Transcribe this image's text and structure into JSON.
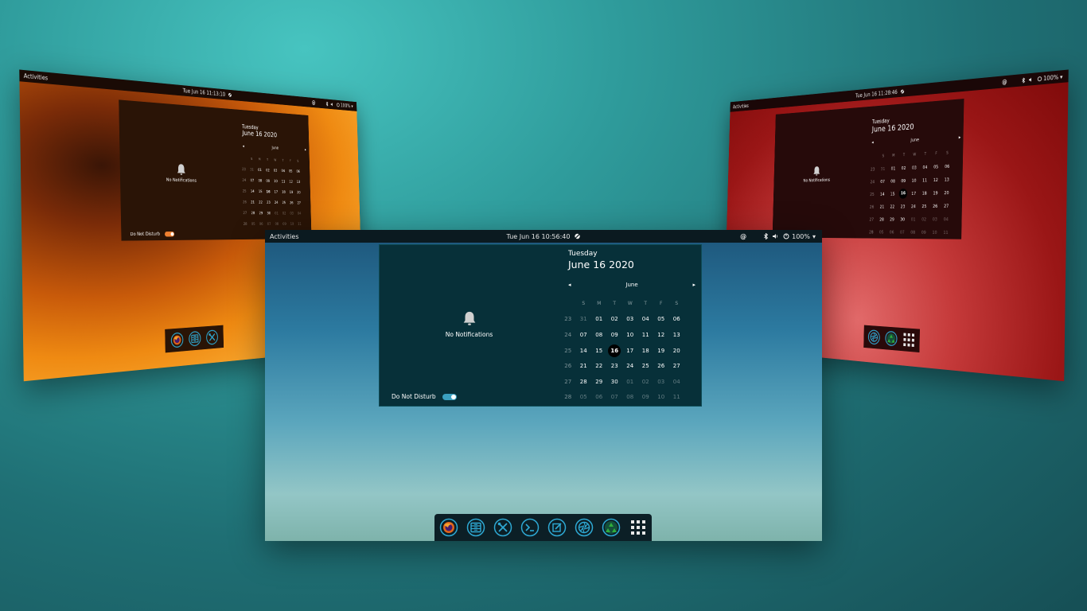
{
  "screens": {
    "orange": {
      "activities": "Activities",
      "clock": "Tue Jun 16  11:13:10",
      "tray_at": "@",
      "battery": "100%",
      "popup": {
        "weekday": "Tuesday",
        "date": "June 16 2020",
        "month": "June",
        "no_notifications": "No Notifications",
        "dnd_label": "Do Not Disturb"
      },
      "accent": "#f08030"
    },
    "red": {
      "activities": "Activities",
      "clock": "Tue Jun 16  11:28:46",
      "tray_at": "@",
      "battery": "100%",
      "popup": {
        "weekday": "Tuesday",
        "date": "June 16 2020",
        "month": "June",
        "no_notifications": "No Notifications"
      },
      "accent": "#b81f1f"
    },
    "main": {
      "activities": "Activities",
      "clock": "Tue Jun 16  10:56:40",
      "tray_at": "@",
      "battery": "100%",
      "popup": {
        "weekday": "Tuesday",
        "date": "June 16 2020",
        "month": "June",
        "no_notifications": "No Notifications",
        "dnd_label": "Do Not Disturb"
      },
      "accent": "#3aa0c0"
    }
  },
  "calendar": {
    "day_headers": [
      "S",
      "M",
      "T",
      "W",
      "T",
      "F",
      "S"
    ],
    "weeks": [
      {
        "wk": "23",
        "days": [
          "31",
          "01",
          "02",
          "03",
          "04",
          "05",
          "06"
        ],
        "dim": [
          true,
          false,
          false,
          false,
          false,
          false,
          false
        ]
      },
      {
        "wk": "24",
        "days": [
          "07",
          "08",
          "09",
          "10",
          "11",
          "12",
          "13"
        ],
        "dim": [
          false,
          false,
          false,
          false,
          false,
          false,
          false
        ]
      },
      {
        "wk": "25",
        "days": [
          "14",
          "15",
          "16",
          "17",
          "18",
          "19",
          "20"
        ],
        "dim": [
          false,
          false,
          false,
          false,
          false,
          false,
          false
        ]
      },
      {
        "wk": "26",
        "days": [
          "21",
          "22",
          "23",
          "24",
          "25",
          "26",
          "27"
        ],
        "dim": [
          false,
          false,
          false,
          false,
          false,
          false,
          false
        ]
      },
      {
        "wk": "27",
        "days": [
          "28",
          "29",
          "30",
          "01",
          "02",
          "03",
          "04"
        ],
        "dim": [
          false,
          false,
          false,
          true,
          true,
          true,
          true
        ]
      },
      {
        "wk": "28",
        "days": [
          "05",
          "06",
          "07",
          "08",
          "09",
          "10",
          "11"
        ],
        "dim": [
          true,
          true,
          true,
          true,
          true,
          true,
          true
        ]
      }
    ],
    "today": "16"
  },
  "dock": {
    "main": [
      "firefox-icon",
      "files-icon",
      "tools-icon",
      "terminal-icon",
      "text-editor-icon",
      "aperture-icon",
      "recycle-icon",
      "app-grid-icon"
    ],
    "orange": [
      "firefox-icon",
      "files-icon",
      "tools-icon"
    ],
    "red": [
      "aperture-icon",
      "recycle-icon",
      "app-grid-icon"
    ]
  }
}
